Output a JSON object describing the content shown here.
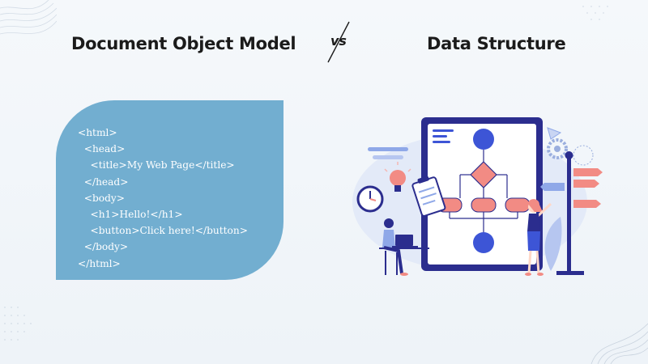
{
  "header": {
    "left_title": "Document Object Model",
    "vs_label": "vs",
    "right_title": "Data Structure"
  },
  "code_card": {
    "lines": [
      "<html>",
      "  <head>",
      "    <title>My Web Page</title>",
      "  </head>",
      "  <body>",
      "    <h1>Hello!</h1>",
      "    <button>Click here!</button>",
      "  </body>",
      "</html>"
    ]
  },
  "colors": {
    "card": "#72aed0",
    "board_frame": "#2b2d8e",
    "node_blue": "#3d55d6",
    "node_pink": "#f28b84",
    "accent_light": "#c9d5f3"
  }
}
